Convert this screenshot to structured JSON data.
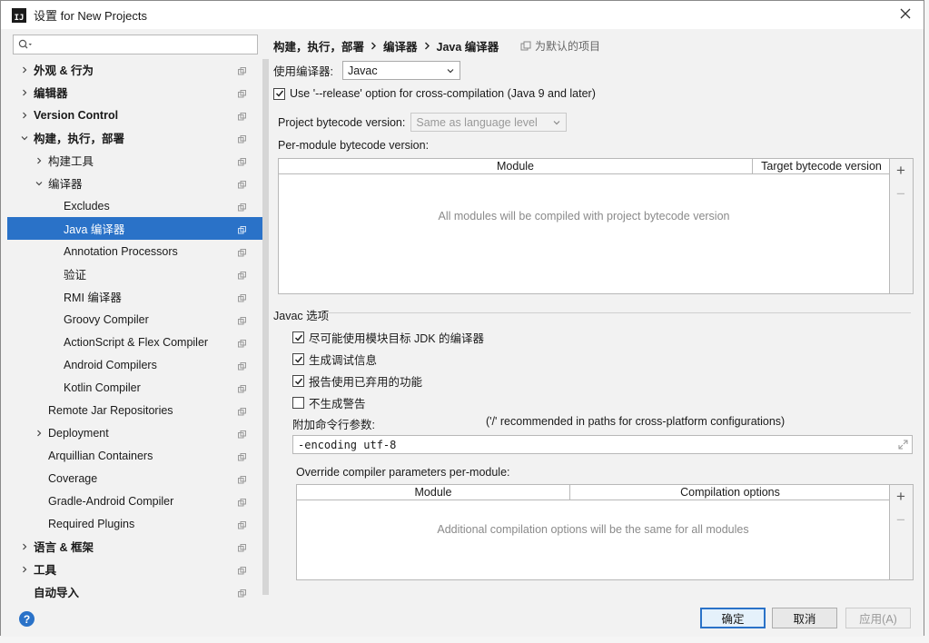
{
  "window": {
    "title": "设置 for New Projects",
    "icon_name": "intellij-icon",
    "icon_text": "IJ"
  },
  "sidebar": {
    "search_placeholder": "",
    "items": [
      {
        "label": "外观 & 行为",
        "level": 0,
        "arrow": "right",
        "bold": true
      },
      {
        "label": "编辑器",
        "level": 0,
        "arrow": "right",
        "bold": true
      },
      {
        "label": "Version Control",
        "level": 0,
        "arrow": "right",
        "bold": true
      },
      {
        "label": "构建，执行，部署",
        "level": 0,
        "arrow": "down",
        "bold": true
      },
      {
        "label": "构建工具",
        "level": 1,
        "arrow": "right",
        "bold": false
      },
      {
        "label": "编译器",
        "level": 1,
        "arrow": "down",
        "bold": false
      },
      {
        "label": "Excludes",
        "level": 2,
        "arrow": "",
        "bold": false
      },
      {
        "label": "Java 编译器",
        "level": 2,
        "arrow": "",
        "bold": false,
        "selected": true
      },
      {
        "label": "Annotation Processors",
        "level": 2,
        "arrow": "",
        "bold": false
      },
      {
        "label": "验证",
        "level": 2,
        "arrow": "",
        "bold": false
      },
      {
        "label": "RMI 编译器",
        "level": 2,
        "arrow": "",
        "bold": false
      },
      {
        "label": "Groovy Compiler",
        "level": 2,
        "arrow": "",
        "bold": false
      },
      {
        "label": "ActionScript & Flex Compiler",
        "level": 2,
        "arrow": "",
        "bold": false
      },
      {
        "label": "Android Compilers",
        "level": 2,
        "arrow": "",
        "bold": false
      },
      {
        "label": "Kotlin Compiler",
        "level": 2,
        "arrow": "",
        "bold": false
      },
      {
        "label": "Remote Jar Repositories",
        "level": 1,
        "arrow": "",
        "bold": false
      },
      {
        "label": "Deployment",
        "level": 1,
        "arrow": "right",
        "bold": false
      },
      {
        "label": "Arquillian Containers",
        "level": 1,
        "arrow": "",
        "bold": false
      },
      {
        "label": "Coverage",
        "level": 1,
        "arrow": "",
        "bold": false
      },
      {
        "label": "Gradle-Android Compiler",
        "level": 1,
        "arrow": "",
        "bold": false
      },
      {
        "label": "Required Plugins",
        "level": 1,
        "arrow": "",
        "bold": false
      },
      {
        "label": "语言 & 框架",
        "level": 0,
        "arrow": "right",
        "bold": true
      },
      {
        "label": "工具",
        "level": 0,
        "arrow": "right",
        "bold": true
      },
      {
        "label": "自动导入",
        "level": 0,
        "arrow": "",
        "bold": true
      }
    ]
  },
  "breadcrumb": {
    "part1": "构建，执行，部署",
    "part2": "编译器",
    "part3": "Java 编译器",
    "default_project": "为默认的项目"
  },
  "compiler": {
    "use_compiler_label": "使用编译器:",
    "use_compiler_value": "Javac",
    "release_option_label": "Use '--release' option for cross-compilation (Java 9 and later)",
    "release_option_checked": true,
    "bytecode_label": "Project bytecode version:",
    "bytecode_value": "Same as language level",
    "per_module_label": "Per-module bytecode version:",
    "module_table": {
      "col_module": "Module",
      "col_target": "Target bytecode version",
      "empty": "All modules will be compiled with project bytecode version"
    }
  },
  "javac": {
    "section_title": "Javac 选项",
    "options": [
      {
        "label": "尽可能使用模块目标 JDK 的编译器",
        "checked": true
      },
      {
        "label": "生成调试信息",
        "checked": true
      },
      {
        "label": "报告使用已弃用的功能",
        "checked": true
      },
      {
        "label": "不生成警告",
        "checked": false
      }
    ],
    "cmd_params_label": "附加命令行参数:",
    "cmd_params_hint": "('/' recommended in paths for cross-platform configurations)",
    "cmd_params_value": "-encoding utf-8",
    "override_label": "Override compiler parameters per-module:",
    "override_table": {
      "col_module": "Module",
      "col_options": "Compilation options",
      "empty": "Additional compilation options will be the same for all modules"
    }
  },
  "tools": {
    "add": "+",
    "remove": "−"
  },
  "buttons": {
    "ok": "确定",
    "cancel": "取消",
    "apply": "应用(A)",
    "help": "?"
  }
}
